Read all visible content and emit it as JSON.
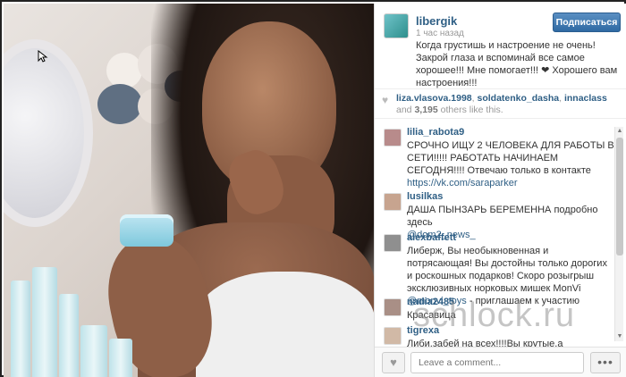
{
  "post": {
    "username": "libergik",
    "time_ago": "1 час назад",
    "follow_label": "Подписаться",
    "caption": "Когда грустишь и настроение не очень! Закрой глаза и вспоминай все самое хорошее!!! Мне помогает!!! ❤ Хорошего вам настроения!!! "
  },
  "likes": {
    "users": [
      "liza.vlasova.1998",
      "soldatenko_dasha",
      "innaclass"
    ],
    "and_text": "and",
    "count": "3,195",
    "suffix": "others like this."
  },
  "comments": [
    {
      "user": "lilia_rabota9",
      "text": "  СРОЧНО ИЩУ 2 ЧЕЛОВЕКА ДЛЯ РАБОТЫ В СЕТИ!!!!! РАБОТАТЬ НАЧИНАЕМ СЕГОДНЯ!!!!   Отвечаю только в контакте",
      "link": "https://vk.com/saraparker"
    },
    {
      "user": "lusilkas",
      "text": "ДАША ПЫНЗАРЬ БЕРЕМЕННА подробно здесь",
      "link": "@dom2_news_"
    },
    {
      "user": "alexbaffett",
      "text": "Либерж, Вы необыкновенная и потрясающая! Вы достойны только дорогих и роскошных подарков! Скоро розыгрыш эксклюзивных норковых мишек MonVi",
      "link": "@monvi_toys",
      "text_after": " - приглашаем к участию"
    },
    {
      "user": "nadia2485",
      "text": "Красавица"
    },
    {
      "user": "tigrexa",
      "text": "Либи,забей на всех!!!!Вы крутые,а остальные"
    }
  ],
  "footer": {
    "comment_placeholder": "Leave a comment...",
    "more_label": "•••"
  },
  "watermark": "schlock.ru",
  "icons": {
    "heart": "heart-icon",
    "cursor": "mouse-cursor-icon"
  },
  "colors": {
    "link": "#2f5f85",
    "follow_button": "#3b73ad"
  }
}
